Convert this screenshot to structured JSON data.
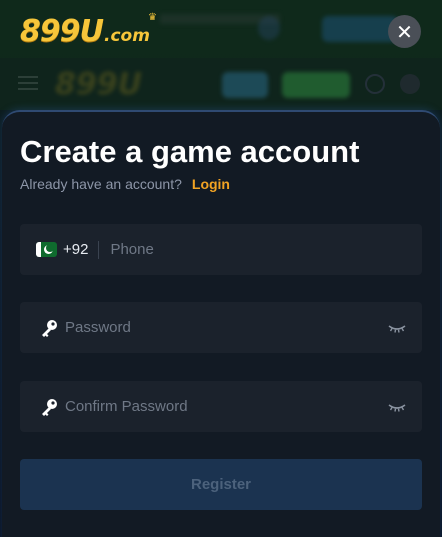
{
  "brand": {
    "logo_main": "899U",
    "logo_sub": ".com"
  },
  "modal": {
    "title": "Create a game account",
    "already_text": "Already have an account?",
    "login_label": "Login",
    "phone": {
      "country_code": "+92",
      "placeholder": "Phone",
      "flag": "pakistan-flag"
    },
    "password": {
      "placeholder": "Password"
    },
    "confirm_password": {
      "placeholder": "Confirm Password"
    },
    "register_label": "Register"
  },
  "icons": {
    "close": "close-icon",
    "key": "key-icon",
    "eye": "eye-closed-icon"
  },
  "colors": {
    "accent": "#f2a323",
    "logo": "#f6c63a",
    "sheet_bg": "#121a24",
    "field_bg": "#1b222c",
    "register_bg": "#1b3350"
  }
}
